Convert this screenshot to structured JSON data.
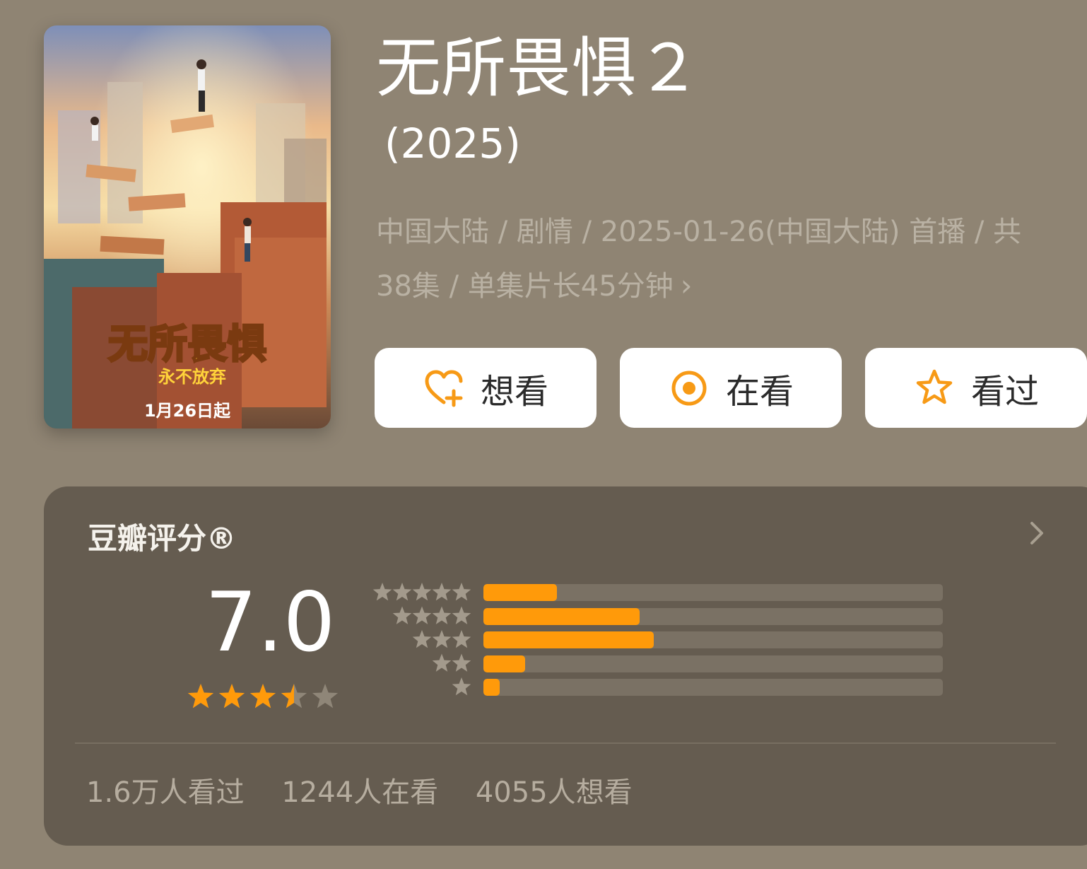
{
  "poster": {
    "title_art": "无所畏惧",
    "subtitle_art": "永不放弃",
    "date_art": "1月26日起"
  },
  "header": {
    "title": "无所畏惧２",
    "year": "(2025)",
    "meta_line1": "中国大陆 / 剧情 / 2025-01-26(中国大陆) 首播 / 共",
    "meta_line2": "38集 / 单集片长45分钟"
  },
  "actions": [
    {
      "label": "想看",
      "icon": "heart-plus-icon"
    },
    {
      "label": "在看",
      "icon": "target-circle-icon"
    },
    {
      "label": "看过",
      "icon": "star-outline-icon"
    }
  ],
  "rating": {
    "title": "豆瓣评分®",
    "score": "7.0",
    "score_value": 7.0,
    "star_fill_fraction": 0.7,
    "distribution": [
      {
        "stars": 5,
        "fraction": 0.16
      },
      {
        "stars": 4,
        "fraction": 0.34
      },
      {
        "stars": 3,
        "fraction": 0.37
      },
      {
        "stars": 2,
        "fraction": 0.09
      },
      {
        "stars": 1,
        "fraction": 0.035
      }
    ],
    "stats": {
      "watched": "1.6万人看过",
      "watching": "1244人在看",
      "want": "4055人想看"
    }
  },
  "colors": {
    "accent": "#ff9a0a",
    "background": "#8f8473",
    "card": "#655c50"
  }
}
